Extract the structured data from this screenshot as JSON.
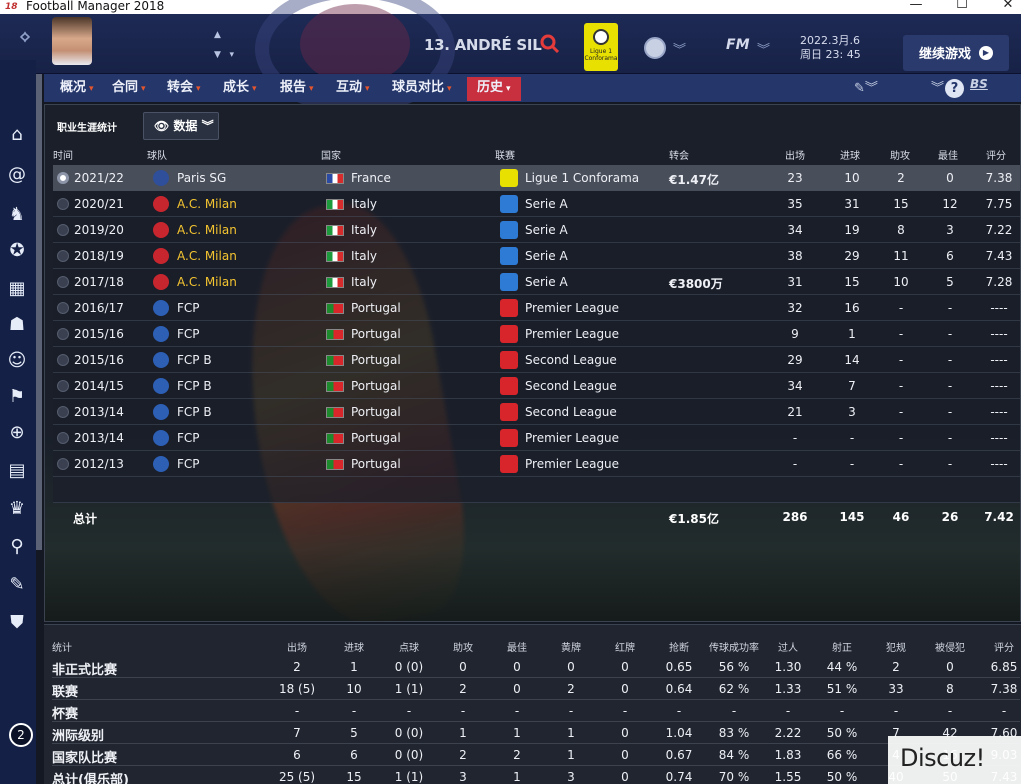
{
  "window": {
    "title": "Football Manager 2018",
    "logo": "18"
  },
  "header": {
    "player_name": "13. ANDRÉ SIL",
    "league_badge": "Ligue 1 Conforama",
    "fm_label": "FM",
    "date": "2022.3月.6",
    "time": "周日 23: 45",
    "continue_label": "继续游戏"
  },
  "tabs": [
    {
      "label": "概况"
    },
    {
      "label": "合同"
    },
    {
      "label": "转会"
    },
    {
      "label": "成长"
    },
    {
      "label": "报告"
    },
    {
      "label": "互动"
    },
    {
      "label": "球员对比"
    },
    {
      "label": "历史"
    }
  ],
  "toolbar": {
    "bs_label": "BS",
    "help_label": "?"
  },
  "career": {
    "subtitle": "职业生涯统计",
    "view_label": "数据",
    "columns": [
      "时间",
      "球队",
      "国家",
      "联赛",
      "转会",
      "出场",
      "进球",
      "助攻",
      "最佳",
      "评分"
    ],
    "rows": [
      {
        "season": "2021/22",
        "club": "Paris SG",
        "country": "France",
        "league": "Ligue 1 Conforama",
        "fee": "€1.47亿",
        "apps": "23",
        "goals": "10",
        "assists": "2",
        "pom": "0",
        "rating": "7.38"
      },
      {
        "season": "2020/21",
        "club": "A.C. Milan",
        "country": "Italy",
        "league": "Serie A",
        "fee": "",
        "apps": "35",
        "goals": "31",
        "assists": "15",
        "pom": "12",
        "rating": "7.75"
      },
      {
        "season": "2019/20",
        "club": "A.C. Milan",
        "country": "Italy",
        "league": "Serie A",
        "fee": "",
        "apps": "34",
        "goals": "19",
        "assists": "8",
        "pom": "3",
        "rating": "7.22"
      },
      {
        "season": "2018/19",
        "club": "A.C. Milan",
        "country": "Italy",
        "league": "Serie A",
        "fee": "",
        "apps": "38",
        "goals": "29",
        "assists": "11",
        "pom": "6",
        "rating": "7.43"
      },
      {
        "season": "2017/18",
        "club": "A.C. Milan",
        "country": "Italy",
        "league": "Serie A",
        "fee": "€3800万",
        "apps": "31",
        "goals": "15",
        "assists": "10",
        "pom": "5",
        "rating": "7.28"
      },
      {
        "season": "2016/17",
        "club": "FCP",
        "country": "Portugal",
        "league": "Premier League",
        "fee": "",
        "apps": "32",
        "goals": "16",
        "assists": "-",
        "pom": "-",
        "rating": "----"
      },
      {
        "season": "2015/16",
        "club": "FCP",
        "country": "Portugal",
        "league": "Premier League",
        "fee": "",
        "apps": "9",
        "goals": "1",
        "assists": "-",
        "pom": "-",
        "rating": "----"
      },
      {
        "season": "2015/16",
        "club": "FCP B",
        "country": "Portugal",
        "league": "Second League",
        "fee": "",
        "apps": "29",
        "goals": "14",
        "assists": "-",
        "pom": "-",
        "rating": "----"
      },
      {
        "season": "2014/15",
        "club": "FCP B",
        "country": "Portugal",
        "league": "Second League",
        "fee": "",
        "apps": "34",
        "goals": "7",
        "assists": "-",
        "pom": "-",
        "rating": "----"
      },
      {
        "season": "2013/14",
        "club": "FCP B",
        "country": "Portugal",
        "league": "Second League",
        "fee": "",
        "apps": "21",
        "goals": "3",
        "assists": "-",
        "pom": "-",
        "rating": "----"
      },
      {
        "season": "2013/14",
        "club": "FCP",
        "country": "Portugal",
        "league": "Premier League",
        "fee": "",
        "apps": "-",
        "goals": "-",
        "assists": "-",
        "pom": "-",
        "rating": "----"
      },
      {
        "season": "2012/13",
        "club": "FCP",
        "country": "Portugal",
        "league": "Premier League",
        "fee": "",
        "apps": "-",
        "goals": "-",
        "assists": "-",
        "pom": "-",
        "rating": "----"
      }
    ],
    "total": {
      "label": "总计",
      "fee": "€1.85亿",
      "apps": "286",
      "goals": "145",
      "assists": "46",
      "pom": "26",
      "rating": "7.42"
    }
  },
  "stats": {
    "columns": [
      "统计",
      "出场",
      "进球",
      "点球",
      "助攻",
      "最佳",
      "黄牌",
      "红牌",
      "抢断",
      "传球成功率",
      "过人",
      "射正",
      "犯规",
      "被侵犯",
      "评分"
    ],
    "rows": [
      [
        "非正式比赛",
        "2",
        "1",
        "0 (0)",
        "0",
        "0",
        "0",
        "0",
        "0.65",
        "56 %",
        "1.30",
        "44 %",
        "2",
        "0",
        "6.85"
      ],
      [
        "联赛",
        "18 (5)",
        "10",
        "1 (1)",
        "2",
        "0",
        "2",
        "0",
        "0.64",
        "62 %",
        "1.33",
        "51 %",
        "33",
        "8",
        "7.38"
      ],
      [
        "杯赛",
        "-",
        "-",
        "-",
        "-",
        "-",
        "-",
        "-",
        "-",
        "-",
        "-",
        "-",
        "-",
        "-",
        "-"
      ],
      [
        "洲际级别",
        "7",
        "5",
        "0 (0)",
        "1",
        "1",
        "1",
        "0",
        "1.04",
        "83 %",
        "2.22",
        "50 %",
        "7",
        "42",
        "7.60"
      ],
      [
        "国家队比赛",
        "6",
        "6",
        "0 (0)",
        "2",
        "2",
        "1",
        "0",
        "0.67",
        "84 %",
        "1.83",
        "66 %",
        "4",
        "16",
        "9.03"
      ],
      [
        "总计(俱乐部)",
        "25 (5)",
        "15",
        "1 (1)",
        "3",
        "1",
        "3",
        "0",
        "0.74",
        "70 %",
        "1.55",
        "50 %",
        "40",
        "50",
        "7.43"
      ]
    ]
  },
  "watermark": "Discuz!",
  "sidebar": {
    "badge": "2"
  }
}
